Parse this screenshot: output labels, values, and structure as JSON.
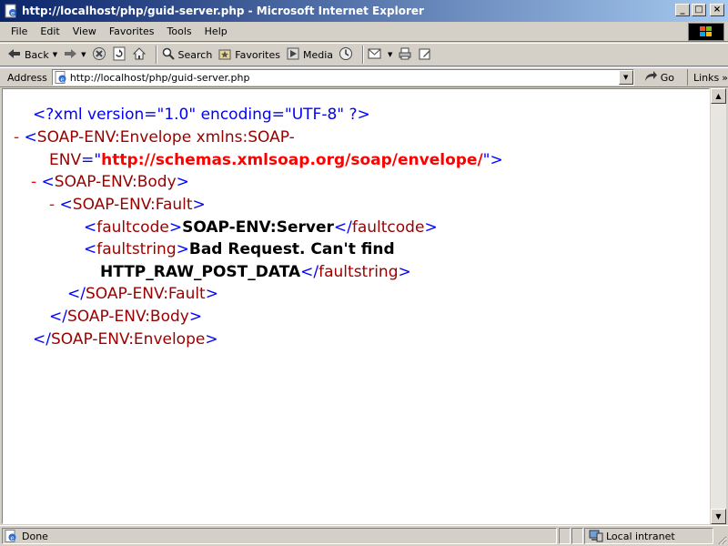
{
  "window": {
    "title": "http://localhost/php/guid-server.php - Microsoft Internet Explorer",
    "minimize_glyph": "_",
    "maximize_glyph": "□",
    "close_glyph": "×"
  },
  "menu": [
    "File",
    "Edit",
    "View",
    "Favorites",
    "Tools",
    "Help"
  ],
  "toolbar": {
    "back_label": "Back",
    "search_label": "Search",
    "favorites_label": "Favorites",
    "media_label": "Media"
  },
  "address": {
    "label": "Address",
    "url": "http://localhost/php/guid-server.php",
    "go_label": "Go",
    "links_label": "Links",
    "links_arrow": "»"
  },
  "xml": {
    "decl": "<?xml version=\"1.0\" encoding=\"UTF-8\" ?>",
    "minus": "-",
    "lt": "<",
    "gt": ">",
    "lt_slash": "</",
    "envelope_tag": "SOAP-ENV:Envelope",
    "xmlns_attr_1": "xmlns:SOAP-",
    "xmlns_attr_2": "ENV",
    "eq_quote": "=\"",
    "quote_gt": "\">",
    "envelope_ns": "http://schemas.xmlsoap.org/soap/envelope/",
    "body_tag": "SOAP-ENV:Body",
    "fault_tag": "SOAP-ENV:Fault",
    "faultcode_tag": "faultcode",
    "faultcode_value": "SOAP-ENV:Server",
    "faultstring_tag": "faultstring",
    "faultstring_value_1": "Bad Request. Can't find",
    "faultstring_value_2": "HTTP_RAW_POST_DATA"
  },
  "status": {
    "text": "Done",
    "zone": "Local intranet"
  },
  "colors": {
    "titlebar_start": "#0a246a",
    "titlebar_end": "#a6caf0",
    "xml_tag": "#990000",
    "xml_markup": "#0000ff",
    "xml_minus": "#ff0000"
  }
}
